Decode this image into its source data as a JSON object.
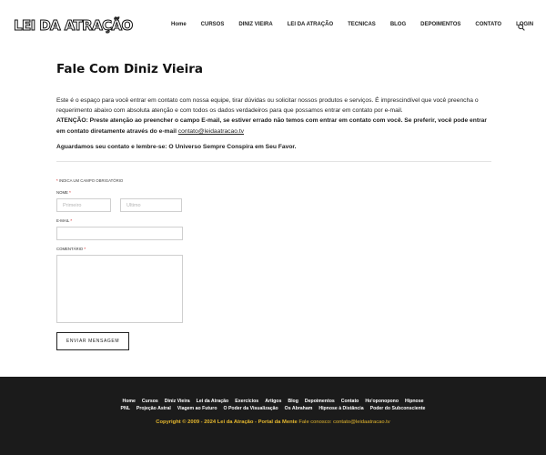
{
  "header": {
    "logo_text": "LEI DA ATRAÇÃO",
    "nav": [
      "Home",
      "CURSOS",
      "DINIZ VIEIRA",
      "LEI DA ATRAÇÃO",
      "TECNICAS",
      "BLOG",
      "DEPOIMENTOS",
      "CONTATO",
      "LOGIN"
    ],
    "search_icon": "search-icon"
  },
  "main": {
    "title": "Fale Com Diniz Vieira",
    "intro": "Este é o espaço para você entrar em contato com nossa equipe, tirar dúvidas ou solicitar nossos produtos e serviços. É imprescindível que você preencha o requerimento abaixo com absoluta atenção e com todos os dados verdadeiros para que possamos entrar em contato por e-mail.",
    "warning": "ATENÇÃO: Preste atenção ao preencher o campo E-mail, se estiver errado não temos com entrar em contato com você. Se preferir, você pode entrar em contato diretamente através do e-mail",
    "warning_email": "contato@leidaatracao.tv",
    "closing": "Aguardamos seu contato e lembre-se: O Universo Sempre Conspira em Seu Favor."
  },
  "form": {
    "required_note": "INDICA UM CAMPO OBRIGATÓRIO",
    "required_star": "*",
    "name_label": "NOME",
    "first_placeholder": "Primeiro",
    "last_placeholder": "Último",
    "email_label": "E-MAIL",
    "email_value": "",
    "comment_label": "COMENTÁRIO",
    "comment_value": "",
    "submit_label": "ENVIAR MENSAGEM"
  },
  "footer": {
    "links_row1": [
      "Home",
      "Cursos",
      "Diniz Vieira",
      "Lei da Atração",
      "Exercícios",
      "Artigos",
      "Blog",
      "Depoimentos",
      "Contato",
      "Ho'oponopono",
      "Hipnose"
    ],
    "links_row2": [
      "PNL",
      "Projeção Astral",
      "Viagem ao Futuro",
      "O Poder da Visualização",
      "Os Abraham",
      "Hipnose à Distância",
      "Poder do Subconsciente"
    ],
    "copyright_bold": "Copyright © 2009 - 2024 Lei da Atração - Portal da Mente",
    "copyright_rest": "Fale conosco: contato@leidaatracao.tv"
  },
  "colors": {
    "footer_bg": "#1b1b1b",
    "copyright": "#e6b82e",
    "required": "#cc0000"
  }
}
